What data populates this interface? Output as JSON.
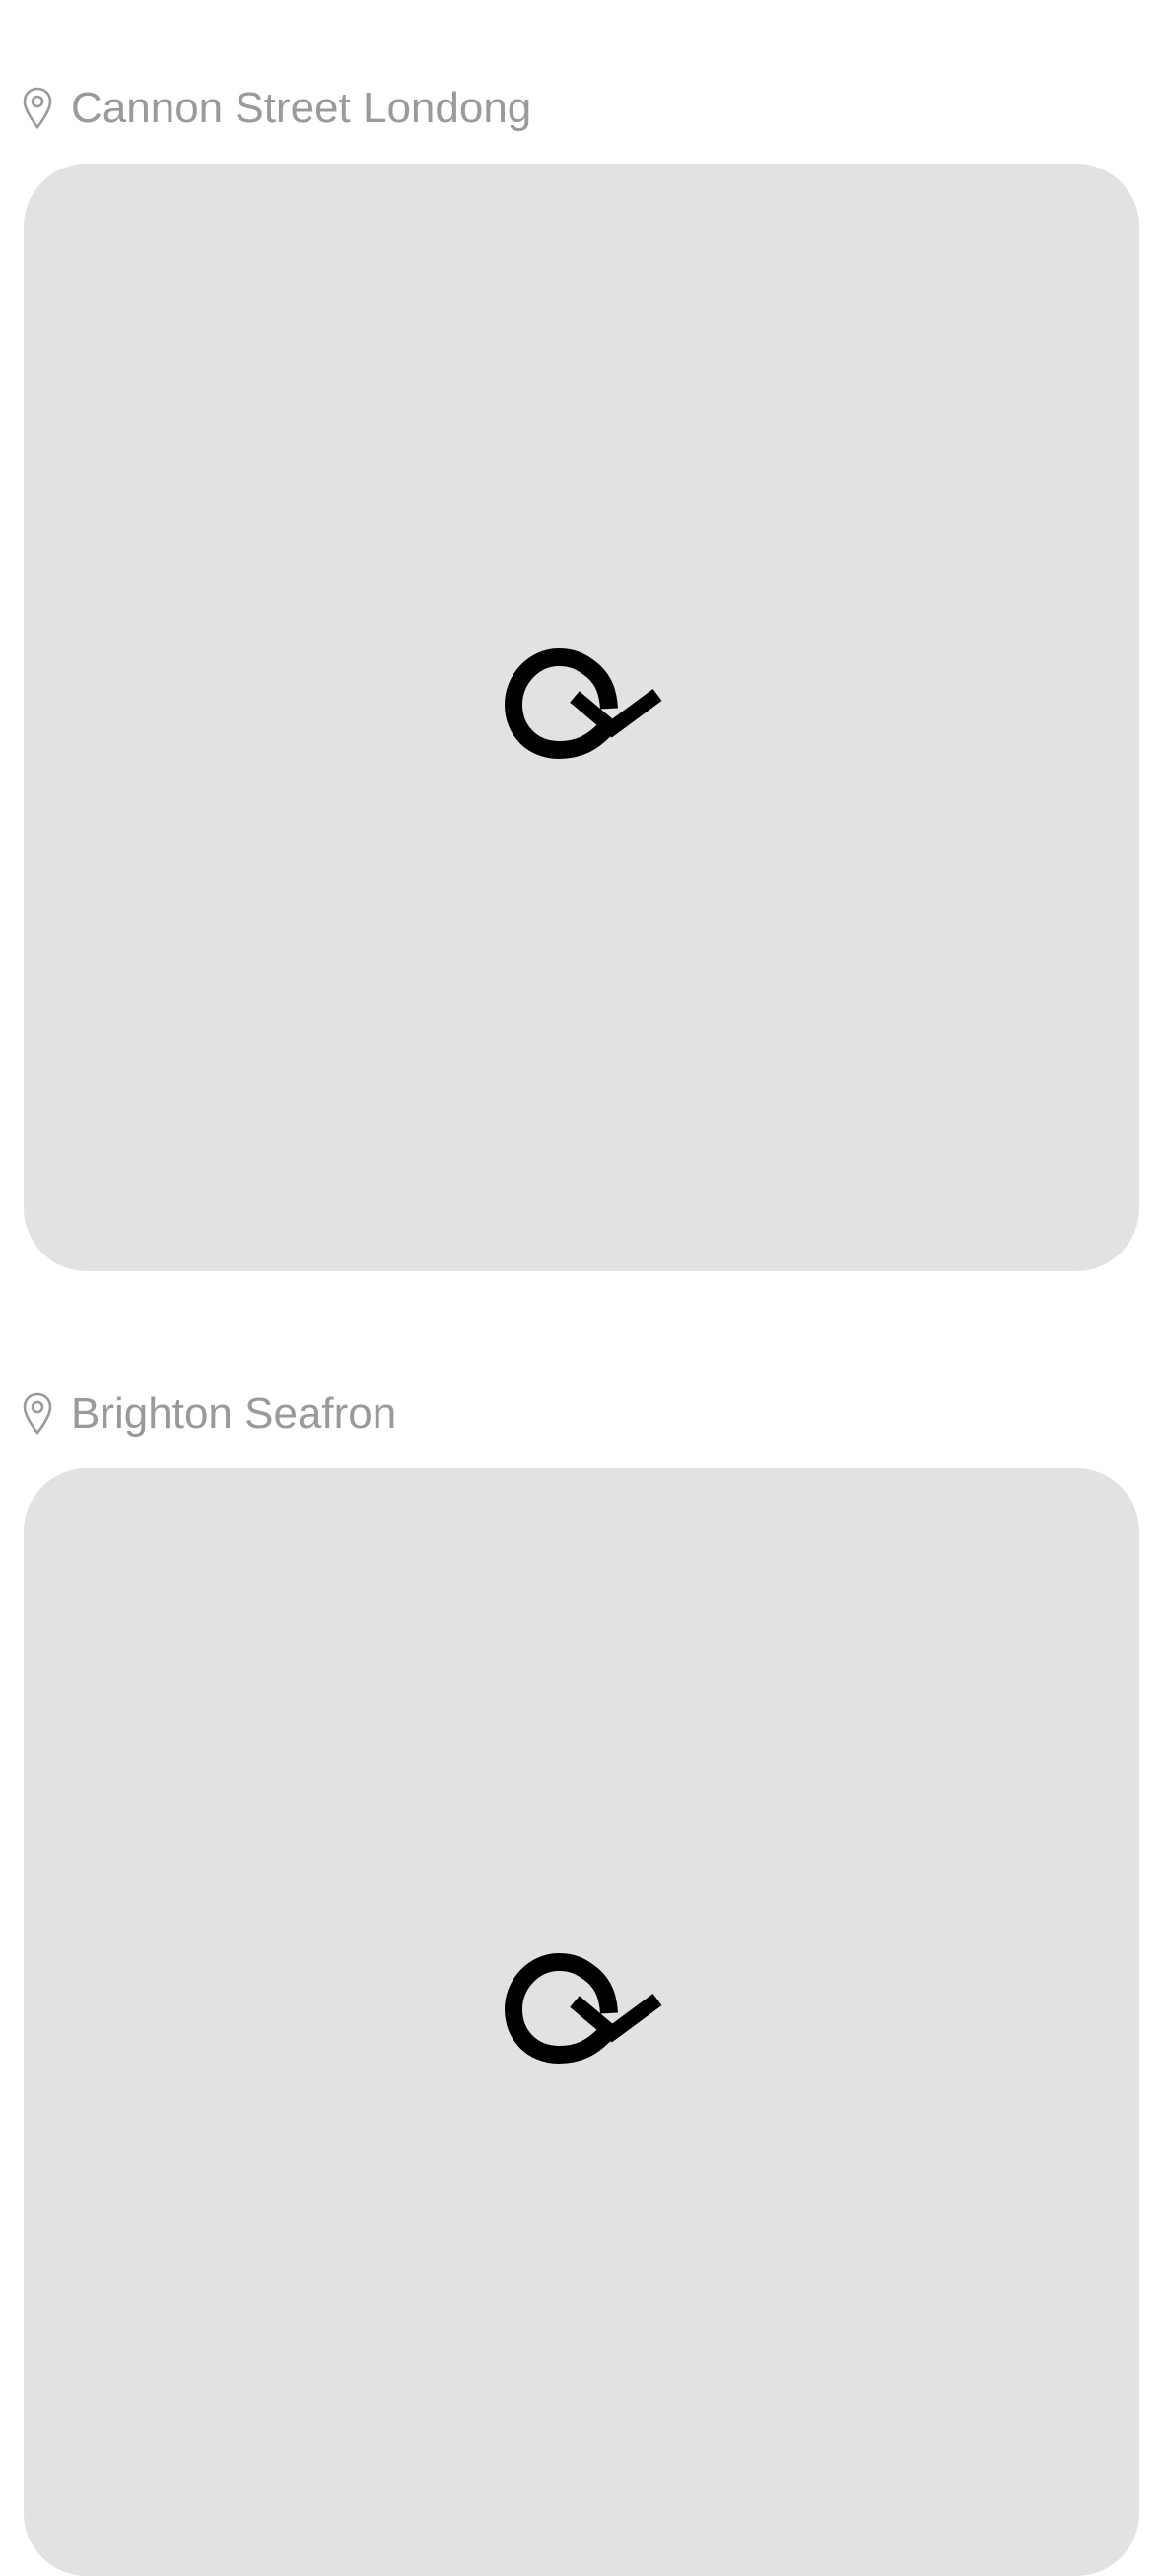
{
  "locations": [
    {
      "label": "Cannon Street Londong",
      "pin_icon": "location-pin-icon",
      "media_icon": "reload-icon"
    },
    {
      "label": "Brighton Seafron",
      "pin_icon": "location-pin-icon",
      "media_icon": "reload-icon"
    }
  ],
  "colors": {
    "background": "#ffffff",
    "card": "#e2e2e2",
    "label": "#9a9a9a",
    "icon": "#000000"
  }
}
